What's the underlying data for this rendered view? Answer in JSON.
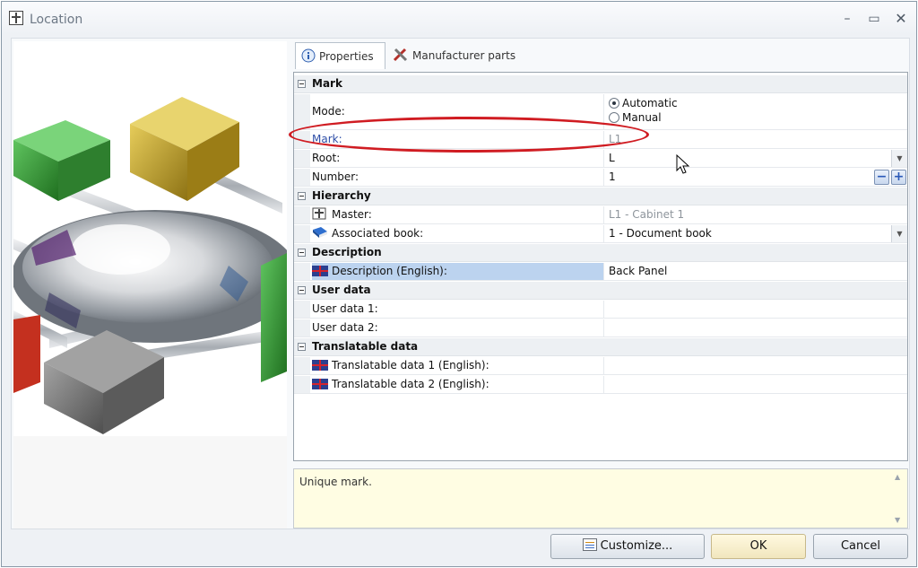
{
  "window": {
    "title": "Location",
    "controls": {
      "minimize": "–",
      "maximize": "▭",
      "close": "✕"
    }
  },
  "tabs": [
    {
      "label": "Properties",
      "icon": "info-icon",
      "active": true
    },
    {
      "label": "Manufacturer parts",
      "icon": "tools-icon",
      "active": false
    }
  ],
  "grid": {
    "categories": {
      "mark": "Mark",
      "hierarchy": "Hierarchy",
      "description": "Description",
      "user_data": "User data",
      "translatable": "Translatable data"
    },
    "mode": {
      "label": "Mode:",
      "options": [
        "Automatic",
        "Manual"
      ],
      "selected": "Automatic"
    },
    "mark": {
      "label": "Mark:",
      "value": "L1"
    },
    "root": {
      "label": "Root:",
      "value": "L"
    },
    "number": {
      "label": "Number:",
      "value": "1",
      "minus": "−",
      "plus": "+"
    },
    "master": {
      "label": "Master:",
      "value": "L1 - Cabinet 1"
    },
    "associated_book": {
      "label": "Associated book:",
      "value": "1 - Document book"
    },
    "description_en": {
      "label": "Description (English):",
      "value": "Back Panel"
    },
    "user_data_1": {
      "label": "User data 1:",
      "value": ""
    },
    "user_data_2": {
      "label": "User data 2:",
      "value": ""
    },
    "translatable_1": {
      "label": "Translatable data 1 (English):",
      "value": ""
    },
    "translatable_2": {
      "label": "Translatable data 2 (English):",
      "value": ""
    }
  },
  "help_text": "Unique mark.",
  "buttons": {
    "customize": "Customize...",
    "ok": "OK",
    "cancel": "Cancel"
  },
  "colors": {
    "highlight": "#d01c22",
    "selected_row": "#bcd3ef",
    "help_background": "#fffde3"
  }
}
